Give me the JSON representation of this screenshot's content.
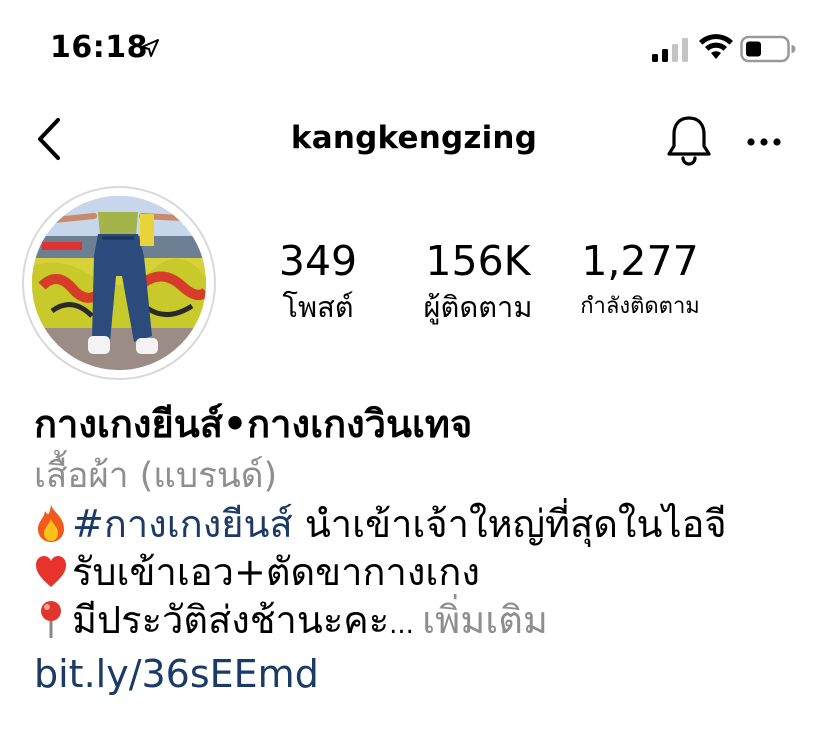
{
  "status_bar": {
    "time": "16:18",
    "location_icon": "location-arrow-icon",
    "signal_icon": "cellular-signal-icon",
    "wifi_icon": "wifi-icon",
    "battery_icon": "battery-icon"
  },
  "nav": {
    "back_icon": "chevron-left-icon",
    "username": "kangkengzing",
    "notification_icon": "bell-icon",
    "more_icon": "more-horizontal-icon"
  },
  "profile": {
    "avatar_icon": "avatar-photo",
    "stats": [
      {
        "value": "349",
        "label": "โพสต์"
      },
      {
        "value": "156K",
        "label": "ผู้ติดตาม"
      },
      {
        "value": "1,277",
        "label": "กำลังติดตาม"
      }
    ]
  },
  "bio": {
    "display_name": "กางเกงยีนส์•กางเกงวินเทจ",
    "category": "เสื้อผ้า (แบรนด์)",
    "line1_hashtag": "#กางเกงยีนส์",
    "line1_text": " นำเข้าเจ้าใหญ่ที่สุดในไอจี",
    "line2_text": "รับเข้าเอว+ตัดขากางเกง",
    "line3_text": "มีประวัติส่งช้านะคะ",
    "line3_ellipsis": "... ",
    "more_label": "เพิ่มเติม",
    "website": "bit.ly/36sEEmd",
    "emoji_fire": "fire-icon",
    "emoji_heart": "heart-icon",
    "emoji_pin": "round-pushpin-icon"
  },
  "colors": {
    "link": "#1b3a66",
    "secondary_text": "#8e8e8e",
    "avatar_ring": "#d9d9d9"
  }
}
